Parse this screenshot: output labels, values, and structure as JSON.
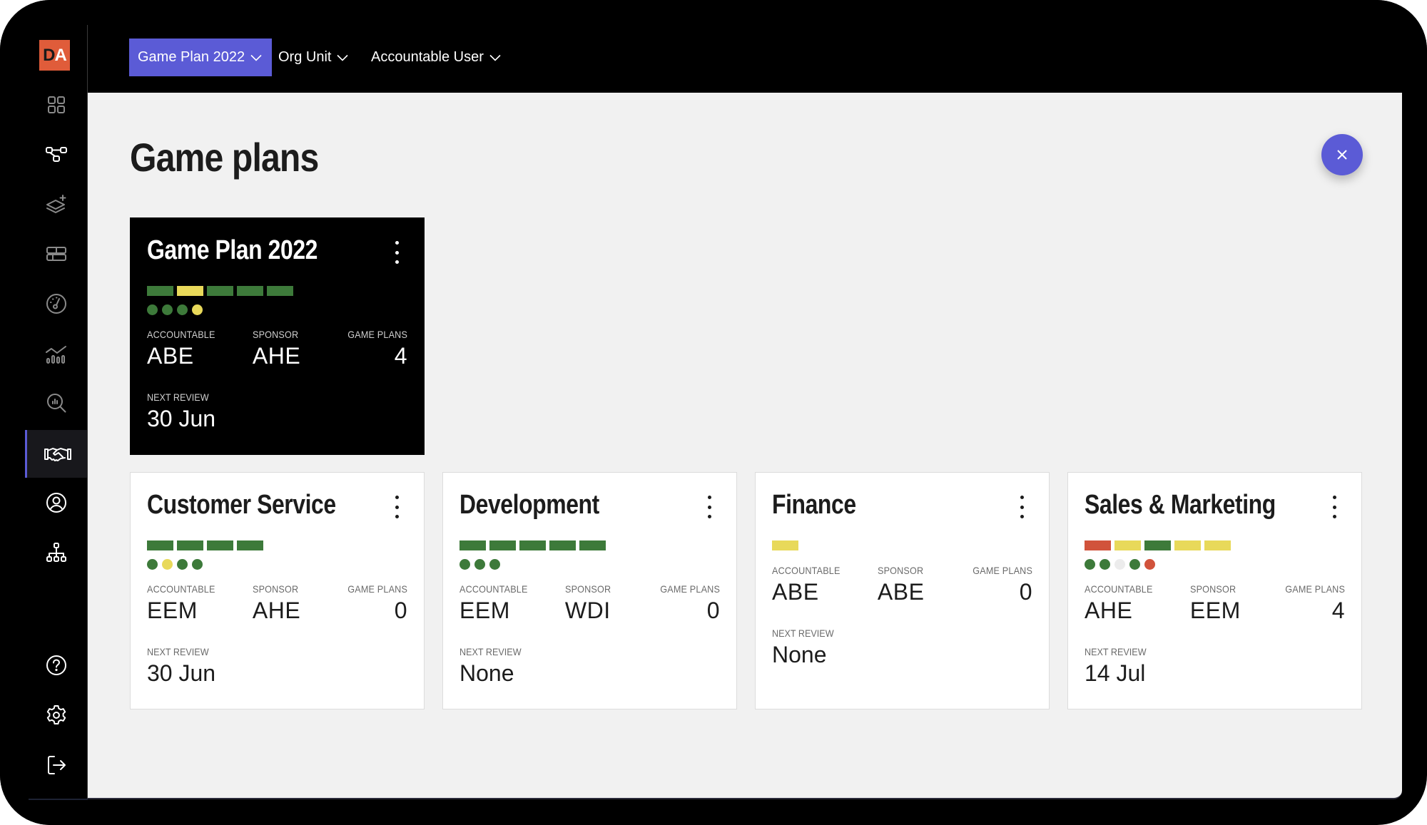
{
  "app": {
    "logo_text_d": "D",
    "logo_text_a": "A"
  },
  "sidebar": {
    "items": [
      {
        "name": "dashboard",
        "icon": "grid-icon",
        "active": false
      },
      {
        "name": "strategy-map",
        "icon": "node-graph-icon",
        "active": false
      },
      {
        "name": "add-layer",
        "icon": "layers-plus-icon",
        "active": false
      },
      {
        "name": "boards",
        "icon": "board-icon",
        "active": false
      },
      {
        "name": "performance",
        "icon": "gauge-icon",
        "active": false
      },
      {
        "name": "analytics",
        "icon": "chart-line-icon",
        "active": false
      },
      {
        "name": "insights",
        "icon": "search-chart-icon",
        "active": false
      },
      {
        "name": "game-plans",
        "icon": "handshake-icon",
        "active": true
      },
      {
        "name": "profile",
        "icon": "user-circle-icon",
        "active": false
      },
      {
        "name": "org-structure",
        "icon": "org-chart-icon",
        "active": false
      }
    ],
    "bottom_items": [
      {
        "name": "help",
        "icon": "help-icon"
      },
      {
        "name": "settings",
        "icon": "gear-icon"
      },
      {
        "name": "logout",
        "icon": "logout-icon"
      }
    ]
  },
  "header": {
    "filters": [
      {
        "label": "Game Plan 2022",
        "selected": true
      },
      {
        "label": "Org Unit",
        "selected": false
      },
      {
        "label": "Accountable User",
        "selected": false
      }
    ]
  },
  "main": {
    "title": "Game plans",
    "close_button": "close-icon"
  },
  "labels": {
    "accountable": "ACCOUNTABLE",
    "sponsor": "SPONSOR",
    "game_plans": "GAME PLANS",
    "next_review": "NEXT REVIEW"
  },
  "colors": {
    "green": "#3d7a3a",
    "yellow": "#e8d95a",
    "red": "#d1533b",
    "grey": "#ececec",
    "accent": "#5b5bd6"
  },
  "cards": [
    {
      "title": "Game Plan 2022",
      "theme": "dark",
      "bars": [
        "green",
        "yellow",
        "green",
        "green",
        "green"
      ],
      "dots": [
        "green",
        "green",
        "green",
        "yellow"
      ],
      "accountable": "ABE",
      "sponsor": "AHE",
      "game_plans": "4",
      "next_review": "30 Jun"
    },
    {
      "title": "Customer Service",
      "theme": "light",
      "bars": [
        "green",
        "green",
        "green",
        "green"
      ],
      "dots": [
        "green",
        "yellow",
        "green",
        "green"
      ],
      "accountable": "EEM",
      "sponsor": "AHE",
      "game_plans": "0",
      "next_review": "30 Jun"
    },
    {
      "title": "Development",
      "theme": "light",
      "bars": [
        "green",
        "green",
        "green",
        "green",
        "green"
      ],
      "dots": [
        "green",
        "green",
        "green"
      ],
      "accountable": "EEM",
      "sponsor": "WDI",
      "game_plans": "0",
      "next_review": "None"
    },
    {
      "title": "Finance",
      "theme": "light",
      "bars": [
        "yellow"
      ],
      "dots": [],
      "accountable": "ABE",
      "sponsor": "ABE",
      "game_plans": "0",
      "next_review": "None"
    },
    {
      "title": "Sales & Marketing",
      "theme": "light",
      "bars": [
        "red",
        "yellow",
        "green",
        "yellow",
        "yellow"
      ],
      "dots": [
        "green",
        "green",
        "grey",
        "green",
        "red"
      ],
      "accountable": "AHE",
      "sponsor": "EEM",
      "game_plans": "4",
      "next_review": "14 Jul"
    }
  ]
}
